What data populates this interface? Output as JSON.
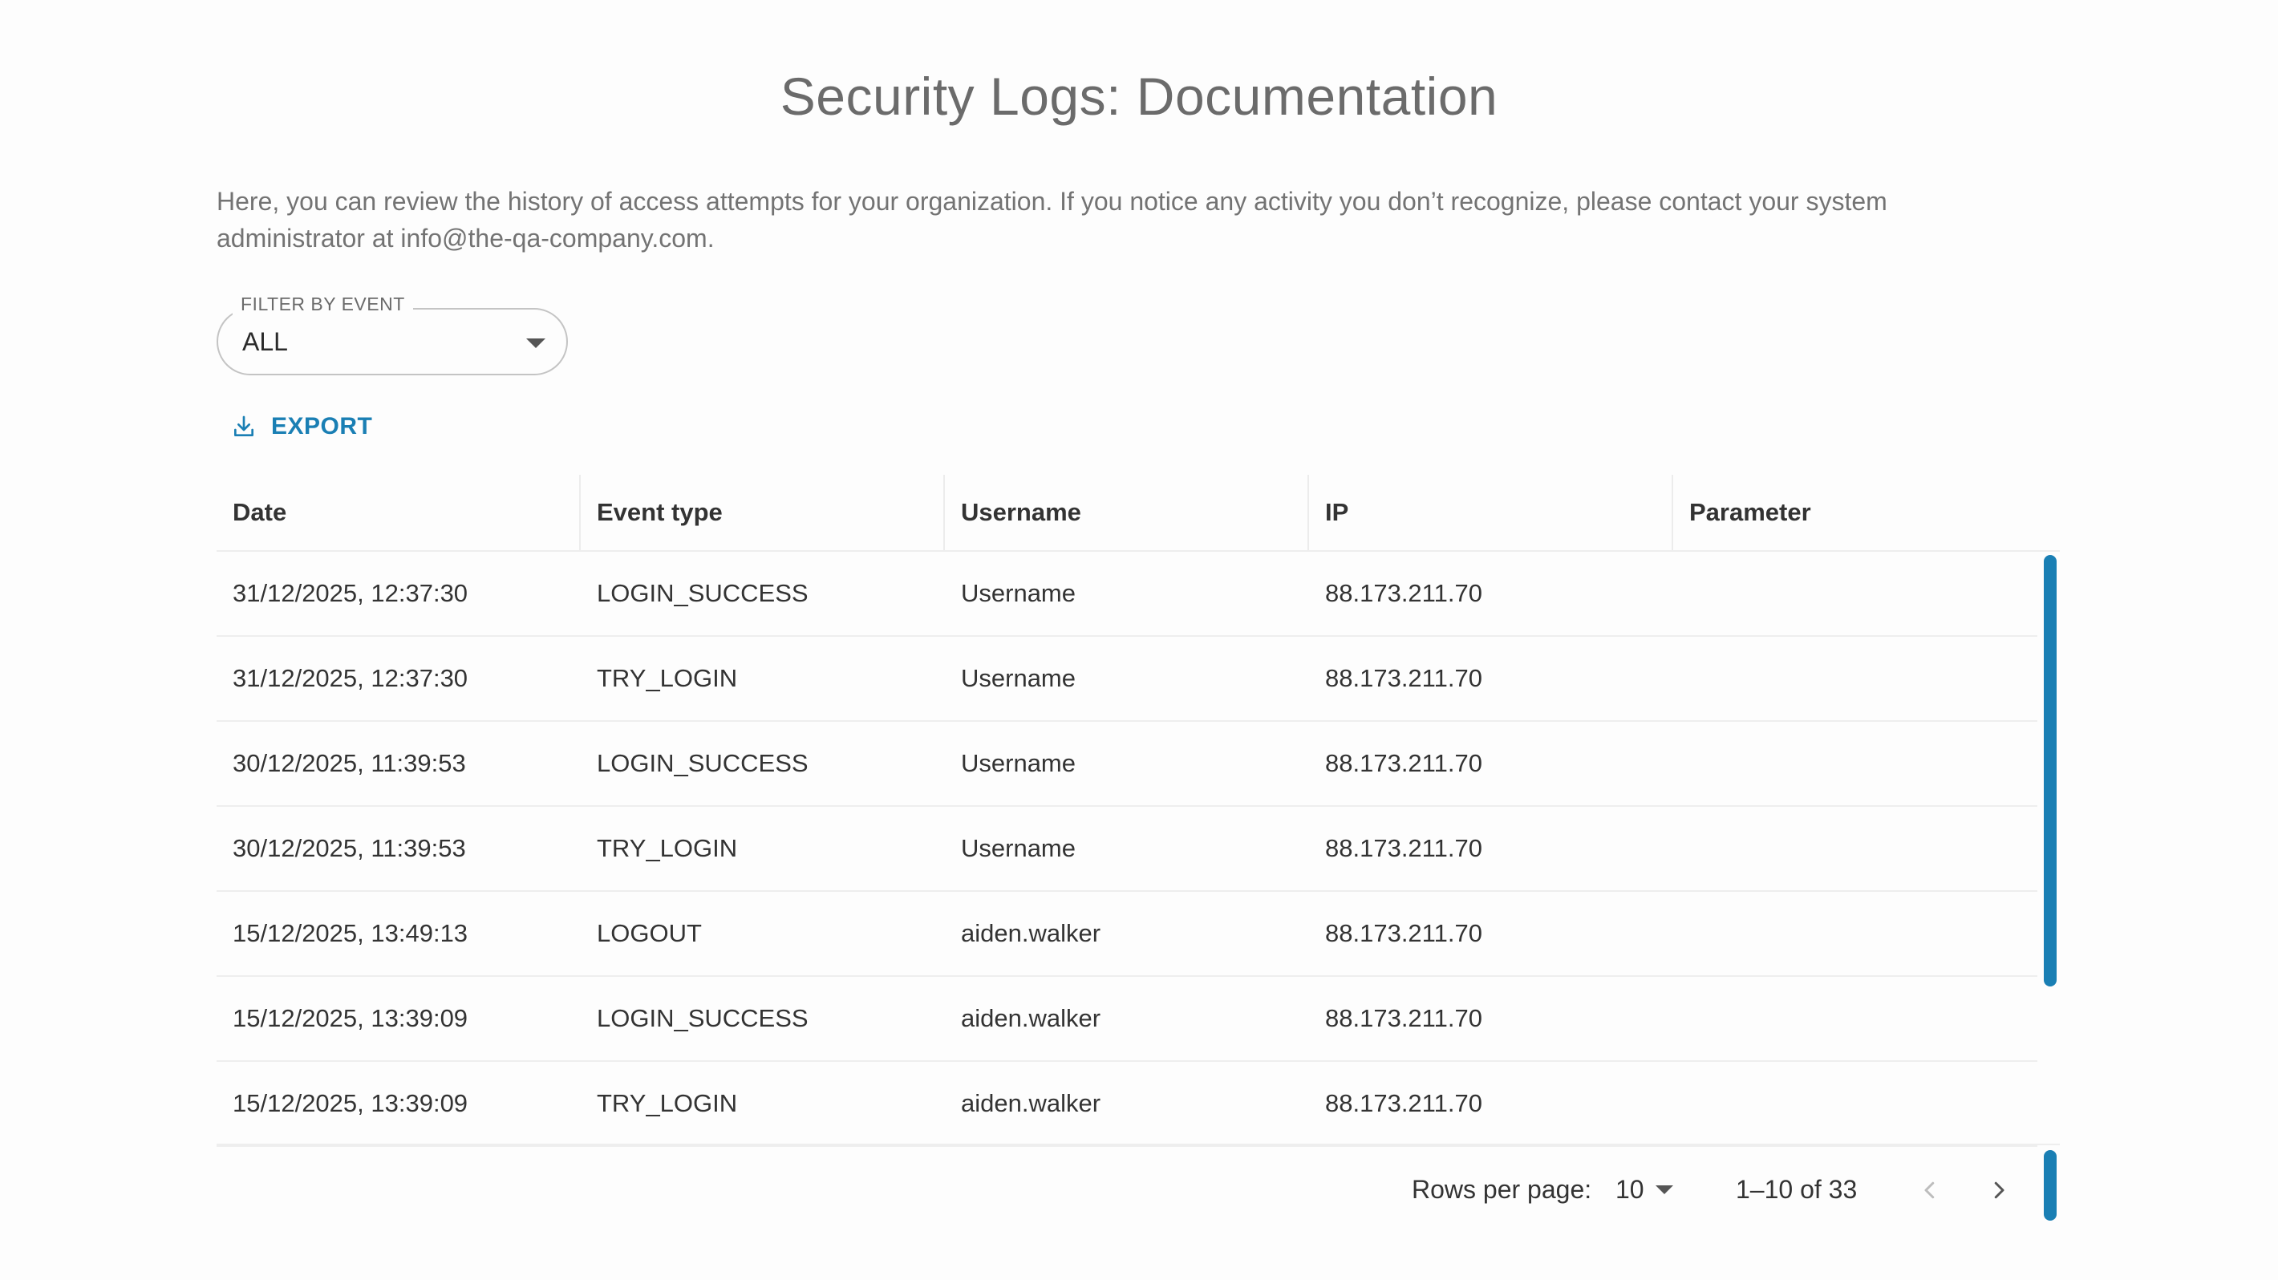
{
  "page": {
    "title": "Security Logs: Documentation",
    "description": "Here, you can review the history of access attempts for your organization. If you notice any activity you don’t recognize, please contact your system administrator at info@the-qa-company.com."
  },
  "filter": {
    "label": "FILTER BY EVENT",
    "value": "ALL"
  },
  "export": {
    "label": "EXPORT",
    "icon": "download-icon"
  },
  "table": {
    "columns": [
      "Date",
      "Event type",
      "Username",
      "IP",
      "Parameter"
    ],
    "rows": [
      [
        "31/12/2025, 12:37:30",
        "LOGIN_SUCCESS",
        "Username",
        "88.173.211.70",
        ""
      ],
      [
        "31/12/2025, 12:37:30",
        "TRY_LOGIN",
        "Username",
        "88.173.211.70",
        ""
      ],
      [
        "30/12/2025, 11:39:53",
        "LOGIN_SUCCESS",
        "Username",
        "88.173.211.70",
        ""
      ],
      [
        "30/12/2025, 11:39:53",
        "TRY_LOGIN",
        "Username",
        "88.173.211.70",
        ""
      ],
      [
        "15/12/2025, 13:49:13",
        "LOGOUT",
        "aiden.walker",
        "88.173.211.70",
        ""
      ],
      [
        "15/12/2025, 13:39:09",
        "LOGIN_SUCCESS",
        "aiden.walker",
        "88.173.211.70",
        ""
      ],
      [
        "15/12/2025, 13:39:09",
        "TRY_LOGIN",
        "aiden.walker",
        "88.173.211.70",
        ""
      ]
    ]
  },
  "pagination": {
    "rows_per_page_label": "Rows per page:",
    "rows_per_page_value": "10",
    "range": "1–10 of 33"
  },
  "colors": {
    "accent": "#1a7fb4"
  }
}
